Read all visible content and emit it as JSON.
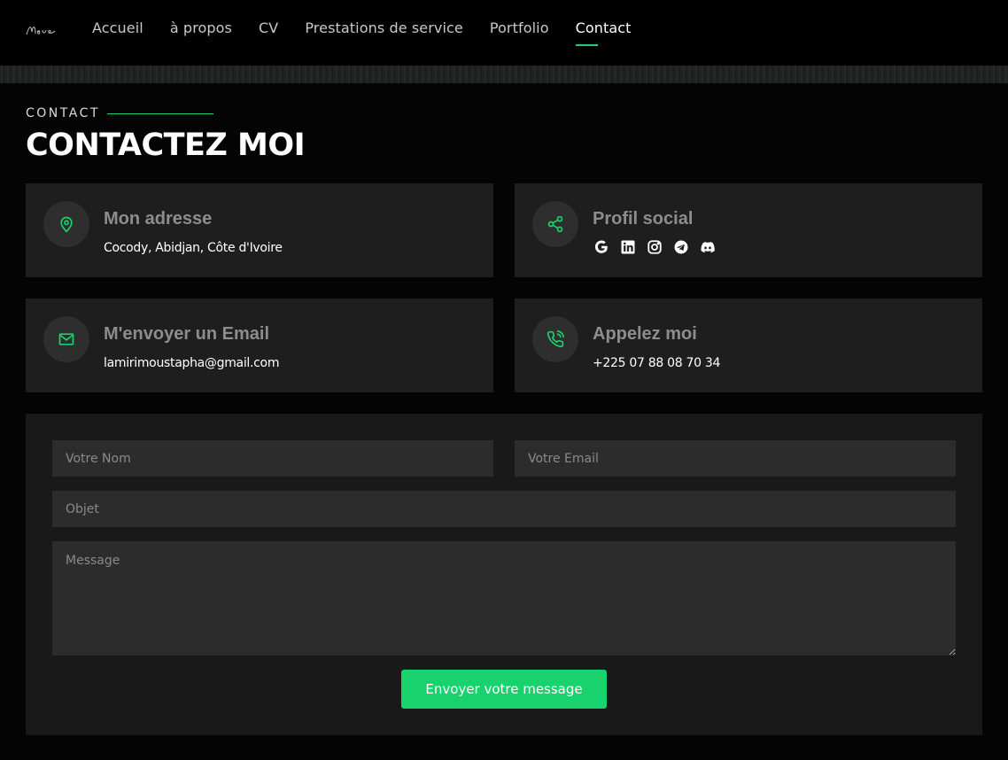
{
  "header": {
    "logo_text": "Mous",
    "nav": [
      {
        "label": "Accueil",
        "active": false
      },
      {
        "label": "à propos",
        "active": false
      },
      {
        "label": "CV",
        "active": false
      },
      {
        "label": "Prestations de service",
        "active": false
      },
      {
        "label": "Portfolio",
        "active": false
      },
      {
        "label": "Contact",
        "active": true
      }
    ]
  },
  "section": {
    "label": "CONTACT",
    "title": "CONTACTEZ MOI"
  },
  "info": {
    "address": {
      "title": "Mon adresse",
      "text": "Cocody, Abidjan, Côte d'Ivoire",
      "icon": "map-pin-icon"
    },
    "social": {
      "title": "Profil social",
      "icon": "share-icon",
      "links": [
        "google-icon",
        "linkedin-icon",
        "instagram-icon",
        "telegram-icon",
        "discord-icon"
      ]
    },
    "email": {
      "title": "M'envoyer un Email",
      "text": "lamirimoustapha@gmail.com",
      "icon": "envelope-icon"
    },
    "phone": {
      "title": "Appelez moi",
      "text": "+225 07 88 08 70 34",
      "icon": "phone-call-icon"
    }
  },
  "form": {
    "name_placeholder": "Votre Nom",
    "email_placeholder": "Votre Email",
    "subject_placeholder": "Objet",
    "message_placeholder": "Message",
    "submit_label": "Envoyer votre message"
  },
  "colors": {
    "accent": "#18d26e",
    "background": "#040404",
    "card": "#1e1e1e",
    "field": "#2c2c2c"
  }
}
